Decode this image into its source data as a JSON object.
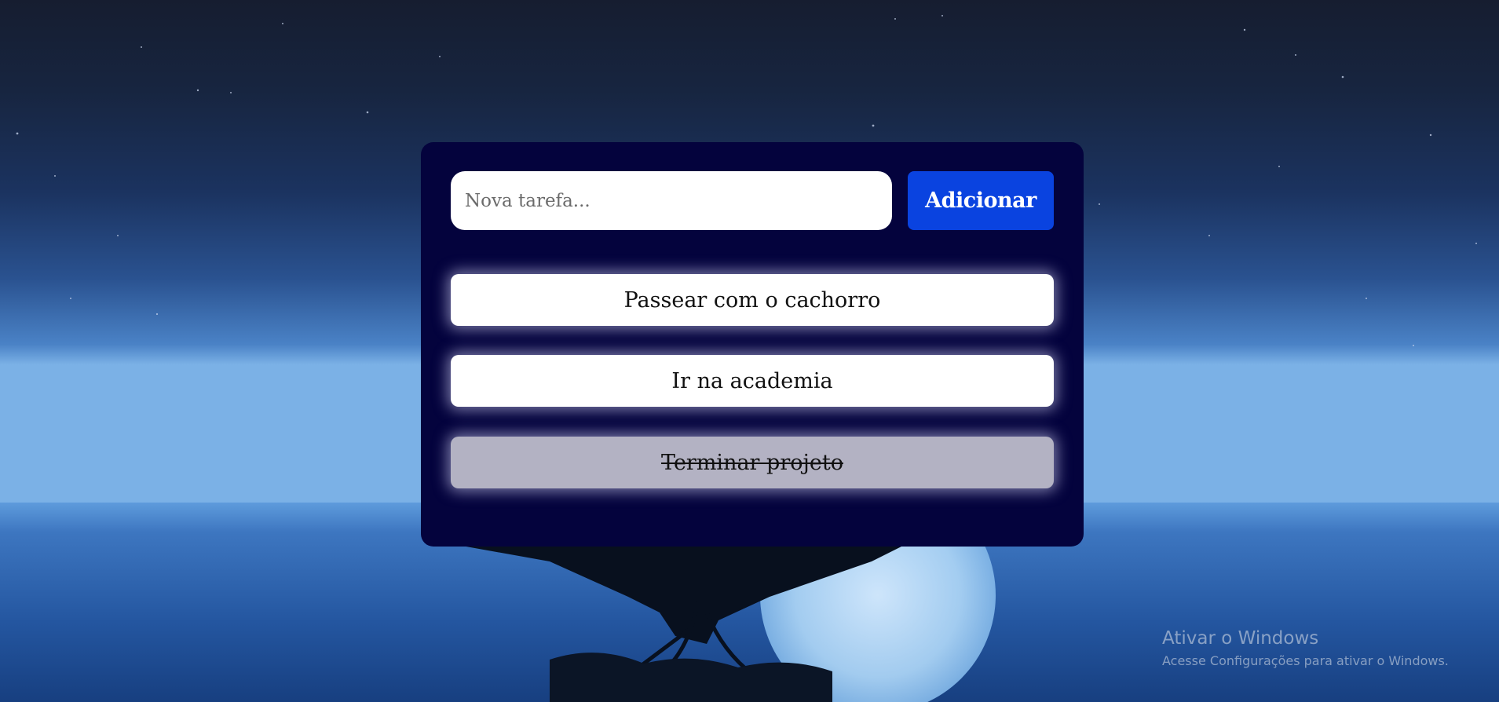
{
  "todo": {
    "input_placeholder": "Nova tarefa...",
    "input_value": "",
    "add_label": "Adicionar",
    "tasks": [
      {
        "text": "Passear com o cachorro",
        "done": false
      },
      {
        "text": "Ir na academia",
        "done": false
      },
      {
        "text": "Terminar projeto",
        "done": true
      }
    ]
  },
  "watermark": {
    "title": "Ativar o Windows",
    "subtitle": "Acesse Configurações para ativar o Windows."
  },
  "colors": {
    "card": "#04033d",
    "button": "#0a43e0",
    "task_done": "#b3b2c3"
  }
}
